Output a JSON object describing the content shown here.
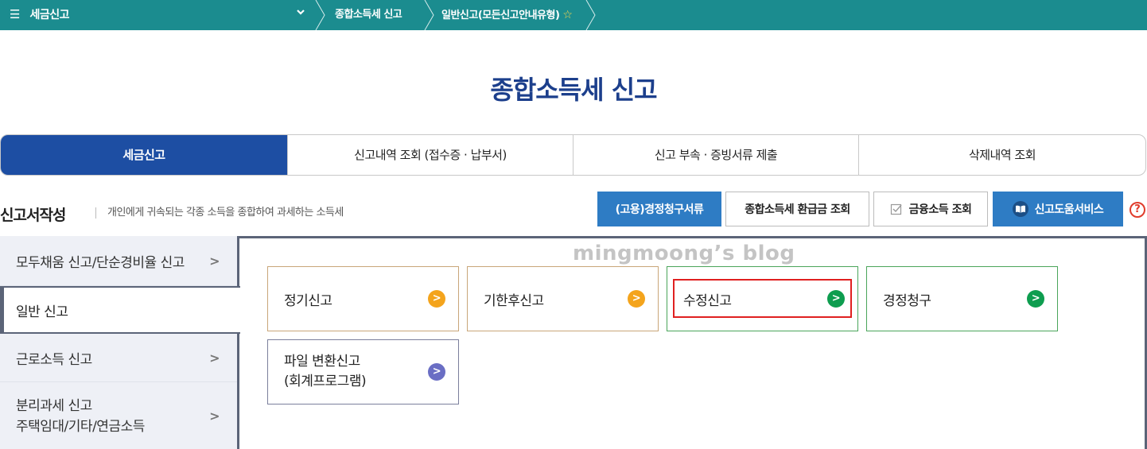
{
  "topbar": {
    "menu_label": "세금신고",
    "crumb1": "종합소득세 신고",
    "crumb2": "일반신고(모든신고안내유형)",
    "bg_color": "#1b8c8f"
  },
  "page_title": "종합소득세 신고",
  "tabs": [
    {
      "label": "세금신고",
      "active": true
    },
    {
      "label": "신고내역 조회 (접수증 · 납부서)"
    },
    {
      "label": "신고 부속 · 증빙서류 제출"
    },
    {
      "label": "삭제내역 조회"
    }
  ],
  "section": {
    "title": "신고서작성",
    "desc": "개인에게 귀속되는 각종 소득을 종합하여 과세하는 소득세"
  },
  "buttons": {
    "claim": "(고용)경정청구서류",
    "refund": "종합소득세 환급금 조회",
    "finance": "금융소득 조회",
    "help_service": "신고도움서비스",
    "help_icon": "?"
  },
  "sidebar": {
    "items": [
      {
        "label": "모두채움 신고/단순경비율 신고"
      },
      {
        "label": "일반 신고"
      },
      {
        "label": "근로소득 신고"
      },
      {
        "label1": "분리과세 신고",
        "label2": "주택임대/기타/연금소득"
      }
    ]
  },
  "watermark": "mingmoong’s blog",
  "cards": [
    {
      "label": "정기신고"
    },
    {
      "label": "기한후신고"
    },
    {
      "label": "수정신고"
    },
    {
      "label": "경정청구"
    },
    {
      "label1": "파일 변환신고",
      "label2": "(회계프로그램)"
    }
  ],
  "colors": {
    "primary": "#1d4ea3",
    "button_blue": "#2e7cc4",
    "orange": "#f4a41c",
    "green": "#0e9d4f",
    "purple": "#6a6ec4",
    "highlight": "#e02020"
  }
}
